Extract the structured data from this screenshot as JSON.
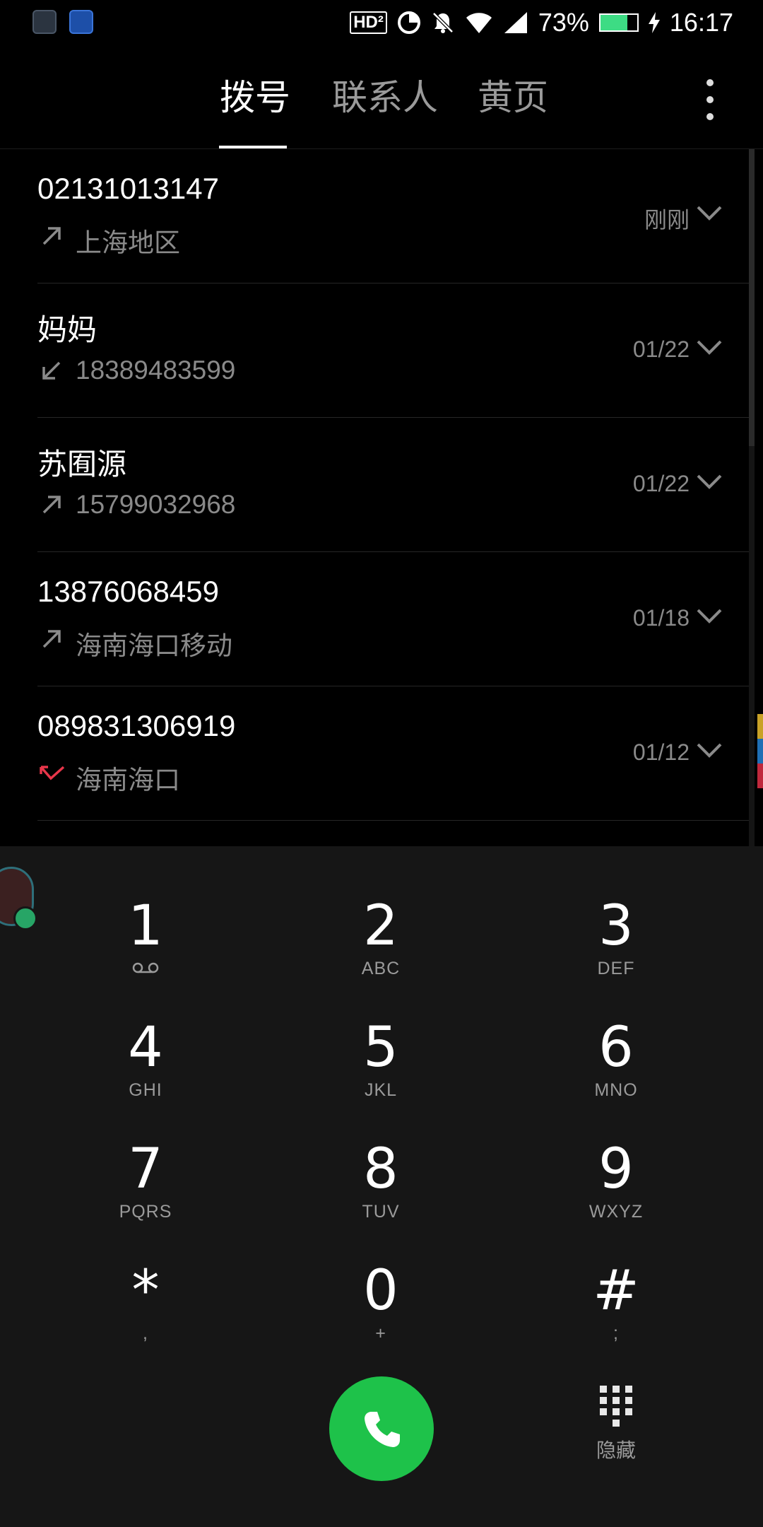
{
  "status_bar": {
    "battery_percent": "73%",
    "battery_level": 0.73,
    "time": "16:17",
    "hd_label": "HD²"
  },
  "tabs": [
    {
      "label": "拨号",
      "active": true
    },
    {
      "label": "联系人",
      "active": false
    },
    {
      "label": "黄页",
      "active": false
    }
  ],
  "call_log": [
    {
      "name": "02131013147",
      "detail": "上海地区",
      "date": "刚刚",
      "direction": "outgoing"
    },
    {
      "name": "妈妈",
      "detail": "18389483599",
      "date": "01/22",
      "direction": "incoming"
    },
    {
      "name": "苏囿源",
      "detail": "15799032968",
      "date": "01/22",
      "direction": "outgoing"
    },
    {
      "name": "13876068459",
      "detail": "海南海口移动",
      "date": "01/18",
      "direction": "outgoing"
    },
    {
      "name": "089831306919",
      "detail": "海南海口",
      "date": "01/12",
      "direction": "missed"
    }
  ],
  "dialpad": {
    "keys": [
      {
        "digit": "1",
        "letters": ""
      },
      {
        "digit": "2",
        "letters": "ABC"
      },
      {
        "digit": "3",
        "letters": "DEF"
      },
      {
        "digit": "4",
        "letters": "GHI"
      },
      {
        "digit": "5",
        "letters": "JKL"
      },
      {
        "digit": "6",
        "letters": "MNO"
      },
      {
        "digit": "7",
        "letters": "PQRS"
      },
      {
        "digit": "8",
        "letters": "TUV"
      },
      {
        "digit": "9",
        "letters": "WXYZ"
      },
      {
        "digit": "*",
        "letters": ","
      },
      {
        "digit": "0",
        "letters": "+"
      },
      {
        "digit": "#",
        "letters": ";"
      }
    ],
    "hide_label": "隐藏"
  },
  "colors": {
    "background": "#000000",
    "dialpad_bg": "#161616",
    "call_button": "#1ec24a",
    "missed_call": "#e8364a",
    "battery": "#3ddc84"
  },
  "icons": {
    "more": "more-vert-icon",
    "chevron": "chevron-down-icon",
    "outgoing": "outgoing-call-arrow-icon",
    "incoming": "incoming-call-arrow-icon",
    "missed": "missed-call-icon",
    "call": "phone-icon",
    "hide": "dialpad-grid-icon",
    "voicemail": "voicemail-icon"
  }
}
